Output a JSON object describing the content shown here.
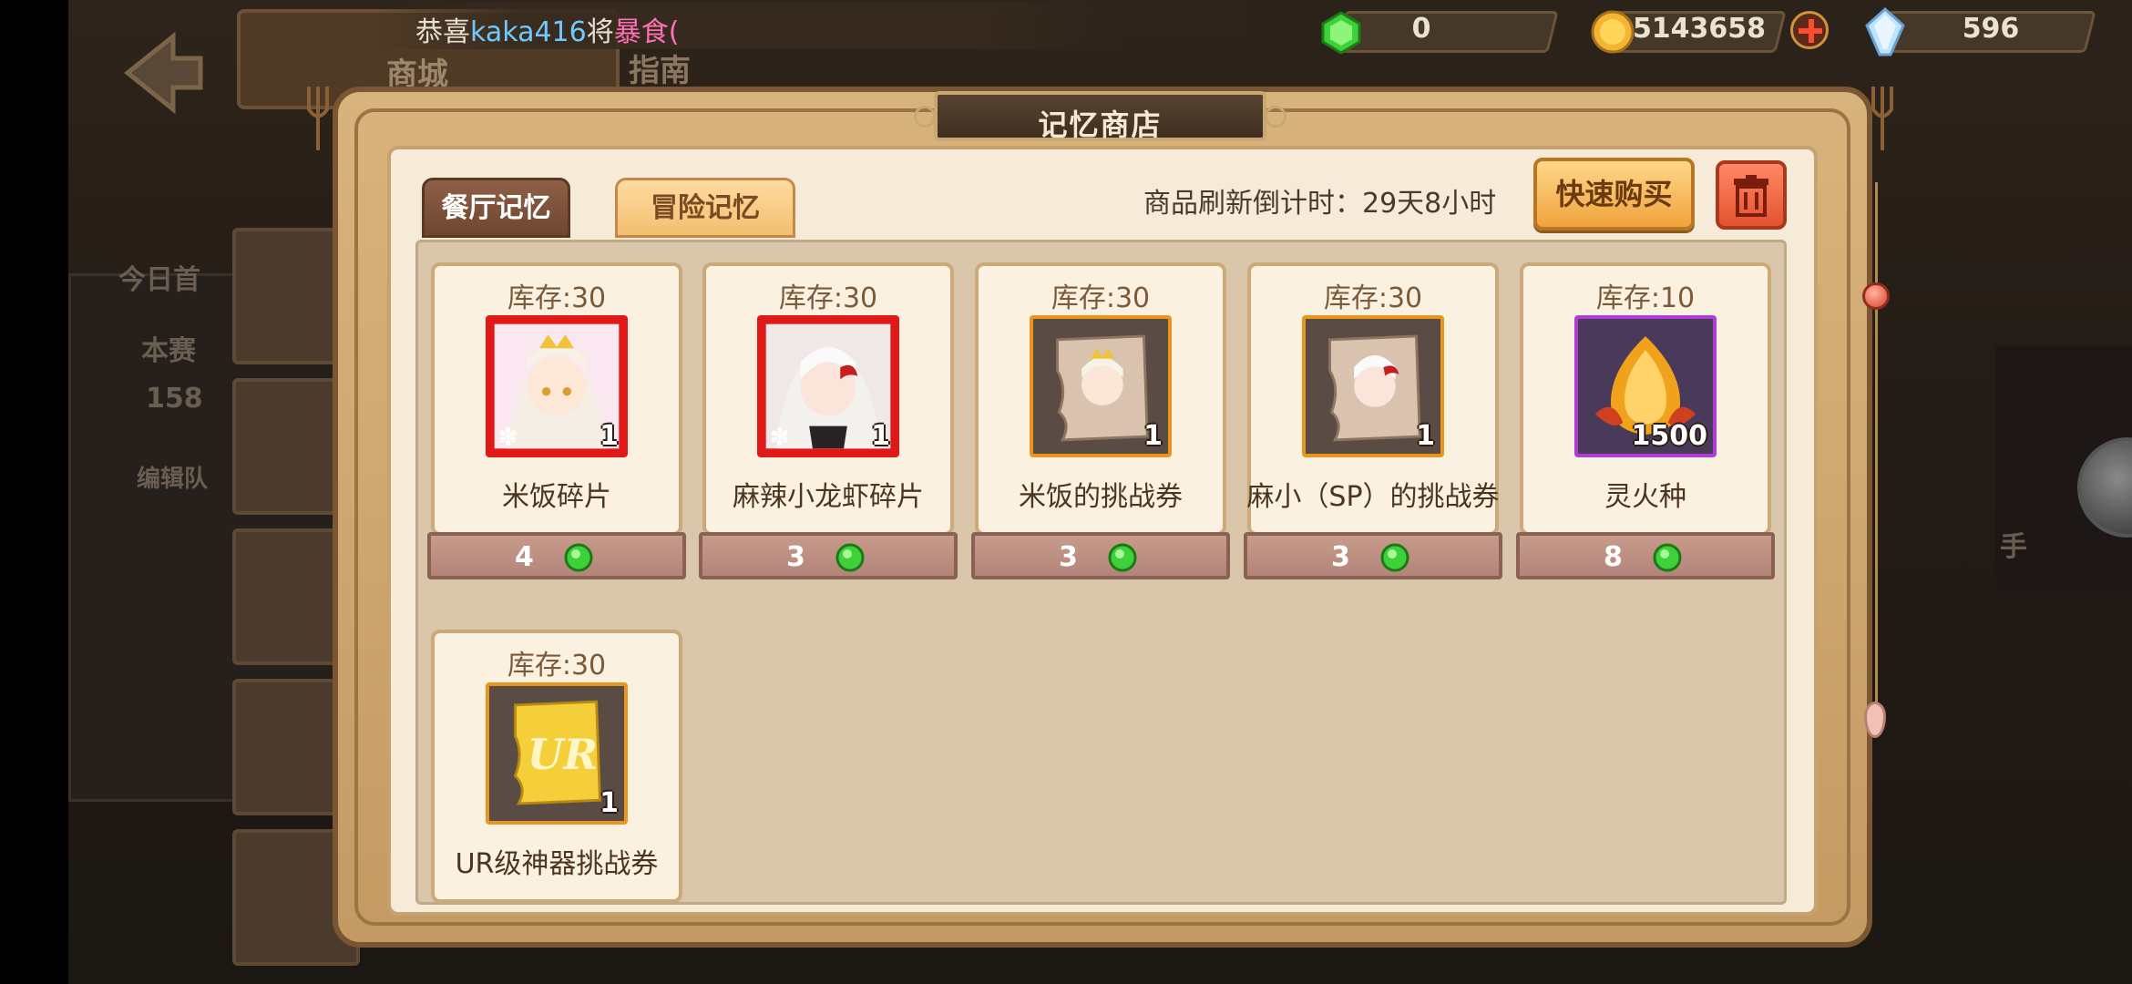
{
  "background": {
    "page_title": "商城",
    "tab2": "指南",
    "side_texts": [
      "今日首",
      "本赛",
      "158",
      "编辑队",
      "手"
    ]
  },
  "marquee": {
    "prefix": "恭喜",
    "user": "kaka416",
    "middle": "将",
    "item": "暴食("
  },
  "resources": {
    "gem_value": "0",
    "coin_value": "5143658",
    "crystal_value": "596"
  },
  "dialog": {
    "title": "记忆商店",
    "tabs": [
      {
        "label": "餐厅记忆",
        "active": true
      },
      {
        "label": "冒险记忆",
        "active": false
      }
    ],
    "refresh_text": "商品刷新倒计时：29天8小时",
    "quick_buy_label": "快速购买",
    "trash_icon": "trash-icon"
  },
  "items": [
    {
      "stock": "库存:30",
      "name": "米饭碎片",
      "qty": "1",
      "price": "4",
      "icon": "rice-fragment-icon"
    },
    {
      "stock": "库存:30",
      "name": "麻辣小龙虾碎片",
      "qty": "1",
      "price": "3",
      "icon": "crayfish-fragment-icon"
    },
    {
      "stock": "库存:30",
      "name": "米饭的挑战券",
      "qty": "1",
      "price": "3",
      "icon": "rice-challenge-ticket-icon"
    },
    {
      "stock": "库存:30",
      "name": "麻小（SP）的挑战券",
      "qty": "1",
      "price": "3",
      "icon": "crayfish-sp-challenge-ticket-icon"
    },
    {
      "stock": "库存:10",
      "name": "灵火种",
      "qty": "1500",
      "price": "8",
      "icon": "spirit-fire-seed-icon"
    },
    {
      "stock": "库存:30",
      "name": "UR级神器挑战券",
      "qty": "1",
      "price": "",
      "icon": "ur-artifact-ticket-icon"
    }
  ],
  "colors": {
    "accent_gem": "#3fd13a",
    "rare_red": "#e01818",
    "rare_orange": "#e8961e",
    "rare_purple": "#b13bd3"
  }
}
